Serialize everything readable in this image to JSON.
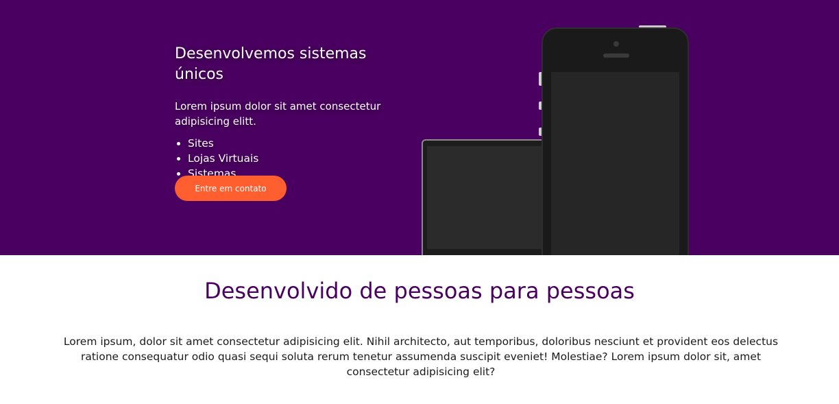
{
  "hero": {
    "title": "Desenvolvemos sistemas únicos",
    "description": "Lorem ipsum dolor sit amet consectetur adipisicing elitt.",
    "services": [
      "Sites",
      "Lojas Virtuais",
      "Sistemas"
    ],
    "cta_label": "Entre em contato",
    "background_color": "#4a0060",
    "cta_color": "#ff5f2e"
  },
  "devices": {
    "laptop_icon": "laptop-mockup",
    "phone_icon": "smartphone-mockup"
  },
  "about": {
    "title": "Desenvolvido de pessoas para pessoas",
    "text": "Lorem ipsum, dolor sit amet consectetur adipisicing elit. Nihil architecto, aut temporibus, doloribus nesciunt et provident eos delectus ratione consequatur odio quasi sequi soluta rerum tenetur assumenda suscipit eveniet! Molestiae? Lorem ipsum dolor sit, amet consectetur adipisicing elit?",
    "title_color": "#4a0060"
  }
}
